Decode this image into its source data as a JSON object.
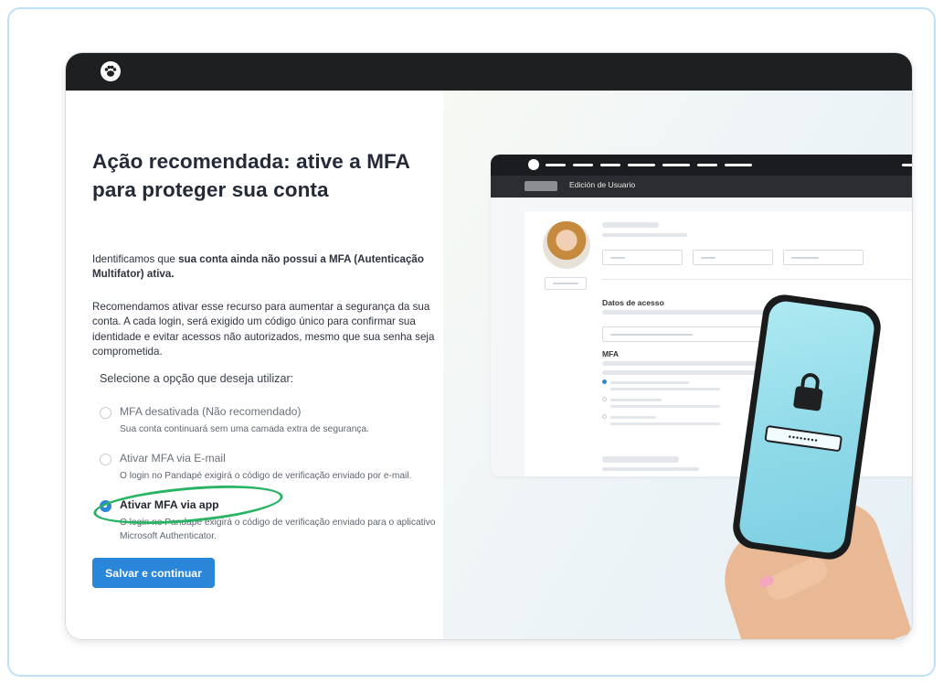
{
  "headline": "Ação recomendada: ative a MFA para proteger sua conta",
  "intro": {
    "before": "Identificamos que ",
    "bold": "sua conta ainda não possui a MFA (Autenticação Multifator) ativa."
  },
  "explanation": "Recomendamos ativar esse recurso para aumentar a segurança da sua conta. A cada login, será exigido um código único para confirmar sua identidade e evitar acessos não autorizados, mesmo que sua senha seja comprometida.",
  "select_label": "Selecione a opção que deseja utilizar:",
  "options": [
    {
      "title": "MFA desativada (Não recomendado)",
      "description": "Sua conta continuará sem uma camada extra de segurança.",
      "selected": false
    },
    {
      "title": "Ativar MFA via E-mail",
      "description": "O login no Pandapé exigirá o código de verificação enviado por e-mail.",
      "selected": false
    },
    {
      "title": "Ativar MFA via app",
      "description": "O login no Pandapé exigirá o código de verificação enviado para o aplicativo Microsoft Authenticator.",
      "selected": true
    }
  ],
  "submit_label": "Salvar e continuar",
  "mock": {
    "page_title": "Edición de Usuario",
    "section_access": "Datos de acesso",
    "section_mfa": "MFA",
    "password_mask": "••••••••"
  },
  "colors": {
    "accent": "#2a86d9",
    "highlight": "#28b463",
    "topbar": "#1e1f21"
  },
  "icons": [
    "paw-logo-icon",
    "lock-icon"
  ]
}
